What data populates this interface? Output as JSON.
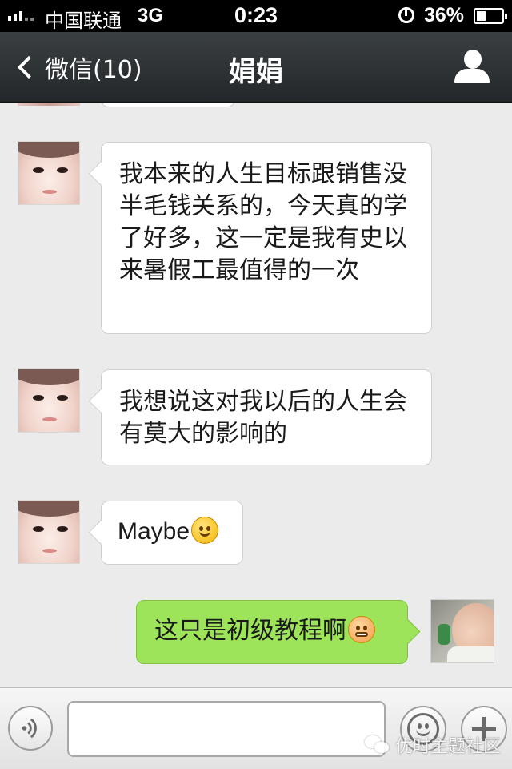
{
  "status_bar": {
    "carrier": "中国联通",
    "network": "3G",
    "time": "0:23",
    "battery": "36%",
    "battery_level": 0.36
  },
  "nav": {
    "back_label": "微信(10)",
    "title": "娟娟"
  },
  "messages": [
    {
      "sender": "contact",
      "text": "我本来的人生目标跟销售没半毛钱关系的，今天真的学了好多，这一定是我有史以来暑假工最值得的一次"
    },
    {
      "sender": "contact",
      "text": "我想说这对我以后的人生会有莫大的影响的"
    },
    {
      "sender": "contact",
      "text": "Maybe",
      "emoji": "smile-emoji"
    },
    {
      "sender": "me",
      "text": "这只是初级教程啊",
      "emoji": "grimace-emoji"
    }
  ],
  "input_bar": {
    "text_value": ""
  },
  "watermark": {
    "text": "优时主题社区"
  },
  "icons": {
    "back": "chevron-left-icon",
    "profile": "person-icon",
    "voice": "voice-icon",
    "emoji": "smiley-icon",
    "more": "plus-icon"
  },
  "colors": {
    "nav_bg": "#2e3336",
    "chat_bg": "#ebebeb",
    "outgoing_bubble": "#9ee45b",
    "incoming_bubble": "#ffffff"
  }
}
